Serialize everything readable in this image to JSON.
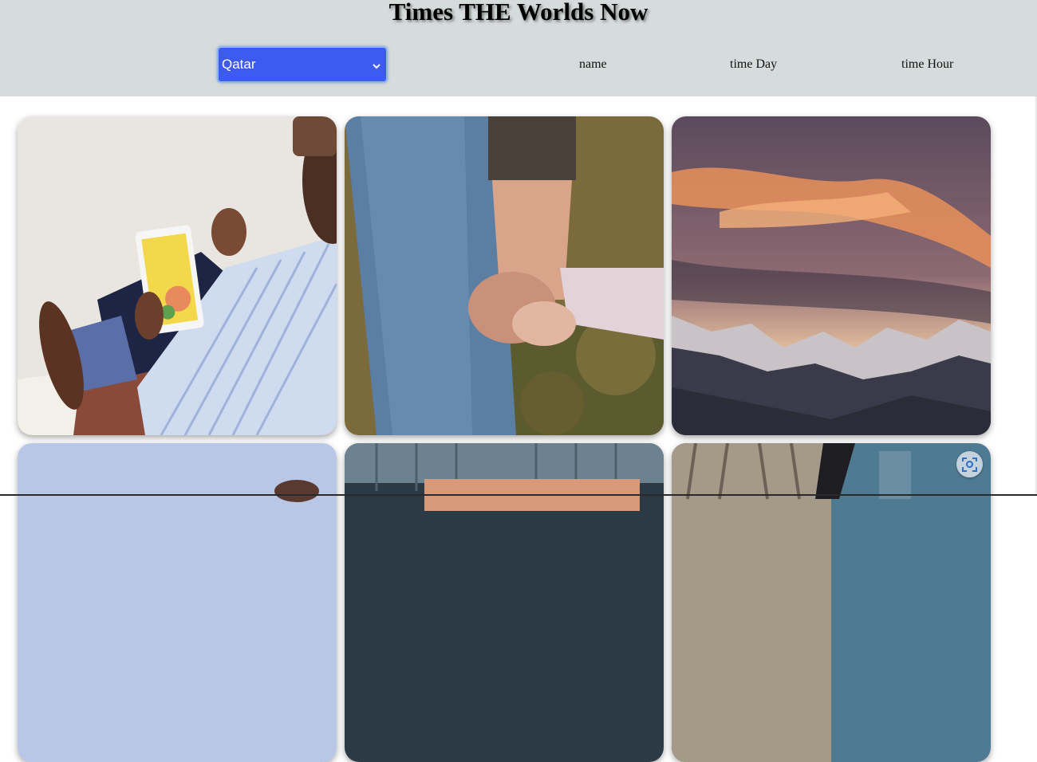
{
  "header": {
    "title": "Times THE Worlds Now",
    "country_select": {
      "selected": "Qatar"
    },
    "columns": {
      "name": "name",
      "time_day": "time Day",
      "time_hour": "time Hour"
    }
  },
  "gallery": {
    "images": [
      {
        "subject": "man-using-tablet"
      },
      {
        "subject": "parent-holding-child-hand"
      },
      {
        "subject": "sunset-mountains"
      },
      {
        "subject": "sky-and-hand"
      },
      {
        "subject": "storefront-sign"
      },
      {
        "subject": "city-street"
      }
    ]
  },
  "colors": {
    "header_bg": "#d6dbdb",
    "select_bg": "#3d5af1",
    "page_bg": "#ffffff"
  },
  "icons": {
    "select_chevron": "chevron-down-icon",
    "visual_search": "visual-search-icon"
  }
}
